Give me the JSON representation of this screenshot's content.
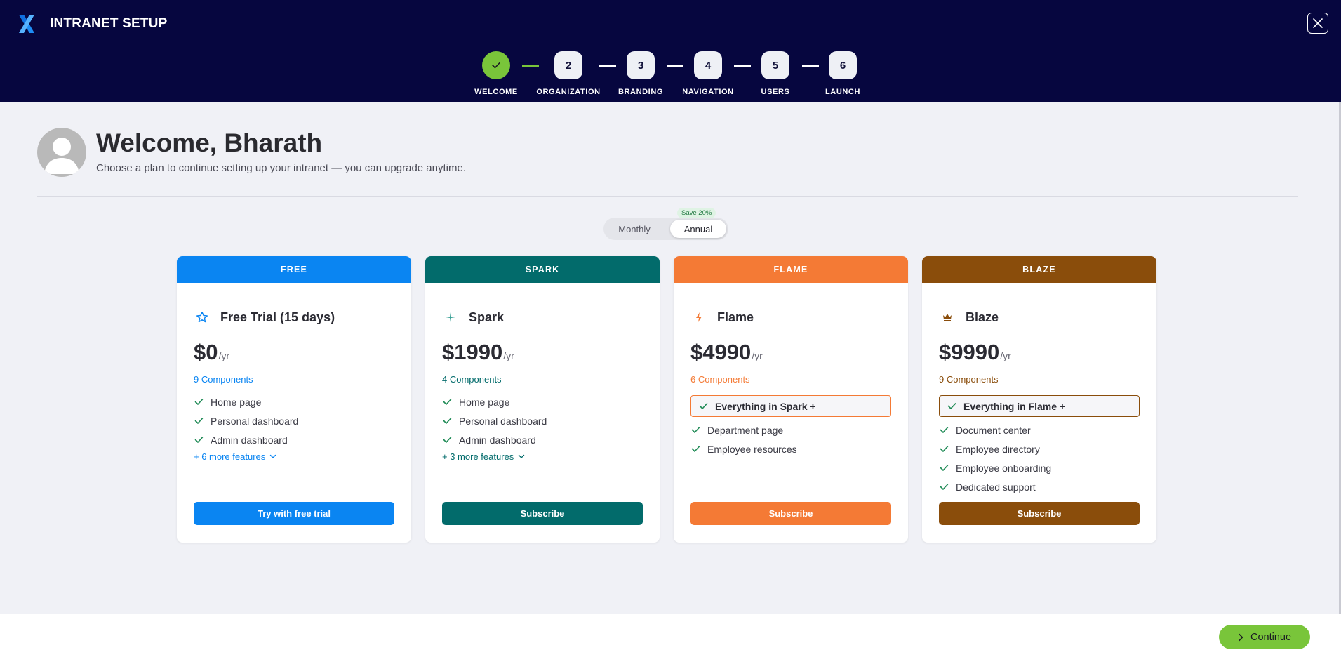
{
  "header": {
    "title": "INTRANET SETUP",
    "steps": [
      {
        "number": "",
        "label": "WELCOME",
        "status": "done"
      },
      {
        "number": "2",
        "label": "ORGANIZATION",
        "status": "pending"
      },
      {
        "number": "3",
        "label": "BRANDING",
        "status": "pending"
      },
      {
        "number": "4",
        "label": "NAVIGATION",
        "status": "pending"
      },
      {
        "number": "5",
        "label": "USERS",
        "status": "pending"
      },
      {
        "number": "6",
        "label": "LAUNCH",
        "status": "pending"
      }
    ]
  },
  "welcome": {
    "title": "Welcome, Bharath",
    "subtitle": "Choose a plan to continue setting up your intranet — you can upgrade anytime."
  },
  "billing_toggle": {
    "monthly": "Monthly",
    "annual": "Annual",
    "selected": "Annual",
    "badge": "Save 20%"
  },
  "plans": [
    {
      "band": "FREE",
      "name": "Free Trial (15 days)",
      "icon": "star-icon",
      "price": "$0",
      "period": "/yr",
      "components": "9 Components",
      "features": [
        "Home page",
        "Personal dashboard",
        "Admin dashboard"
      ],
      "more": "+ 6 more features",
      "button": "Try with free trial",
      "color": "#0a85f2"
    },
    {
      "band": "SPARK",
      "name": "Spark",
      "icon": "sparkle-icon",
      "price": "$1990",
      "period": "/yr",
      "components": "4 Components",
      "features": [
        "Home page",
        "Personal dashboard",
        "Admin dashboard"
      ],
      "more": "+ 3 more features",
      "button": "Subscribe",
      "color": "#026b6b"
    },
    {
      "band": "FLAME",
      "name": "Flame",
      "icon": "bolt-icon",
      "price": "$4990",
      "period": "/yr",
      "components": "6 Components",
      "includes": "Everything in Spark +",
      "features": [
        "Department page",
        "Employee resources"
      ],
      "button": "Subscribe",
      "color": "#f47a35"
    },
    {
      "band": "BLAZE",
      "name": "Blaze",
      "icon": "crown-icon",
      "price": "$9990",
      "period": "/yr",
      "components": "9 Components",
      "includes": "Everything in Flame +",
      "features": [
        "Document center",
        "Employee directory",
        "Employee onboarding",
        "Dedicated support"
      ],
      "button": "Subscribe",
      "color": "#8a4d0b"
    }
  ],
  "footer": {
    "continue": "Continue"
  },
  "colors": {
    "header_bg": "#06063f",
    "accent_green": "#79c53a",
    "check_green": "#1e8a55"
  }
}
